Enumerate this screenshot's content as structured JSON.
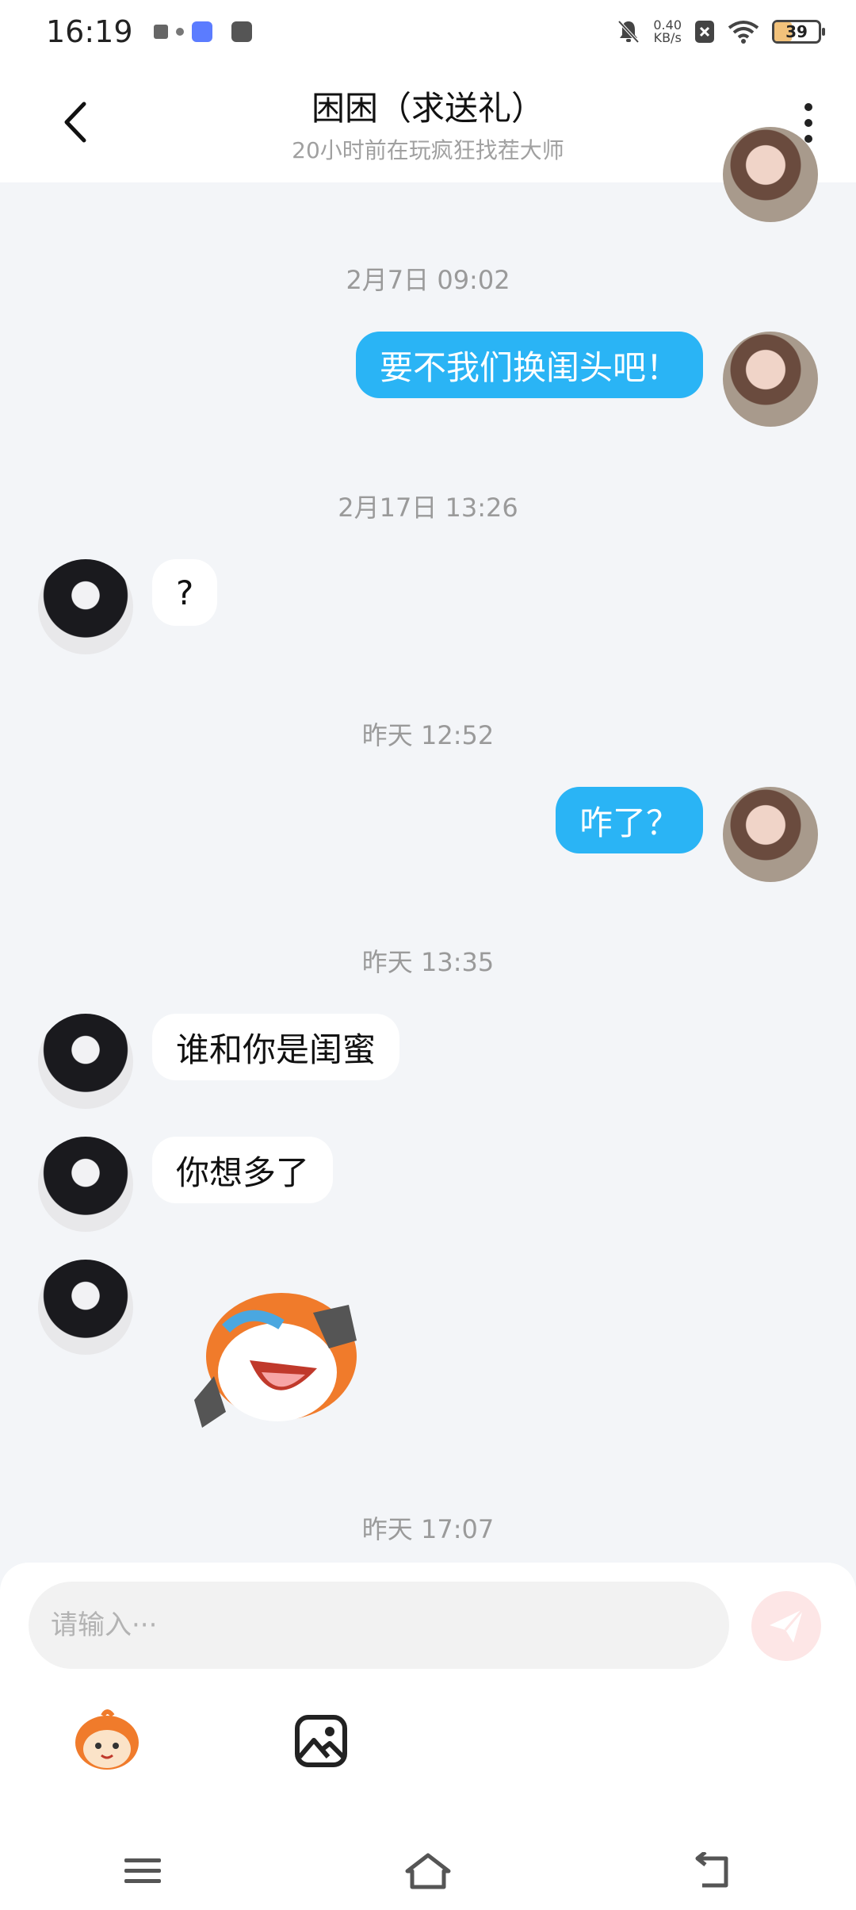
{
  "status": {
    "time": "16:19",
    "net_speed": "0.40",
    "net_unit": "KB/s",
    "battery": "39"
  },
  "header": {
    "title": "困困（求送礼）",
    "subtitle": "20小时前在玩疯狂找茬大师"
  },
  "messages": {
    "ts1": "2月7日 09:02",
    "m1": "要不我们换闺头吧！",
    "ts2": "2月17日 13:26",
    "m2": "?",
    "ts3": "昨天 12:52",
    "m3": "咋了？",
    "ts4": "昨天 13:35",
    "m4": "谁和你是闺蜜",
    "m5": "你想多了",
    "ts5": "昨天 17:07"
  },
  "input": {
    "placeholder": "请输入···"
  }
}
